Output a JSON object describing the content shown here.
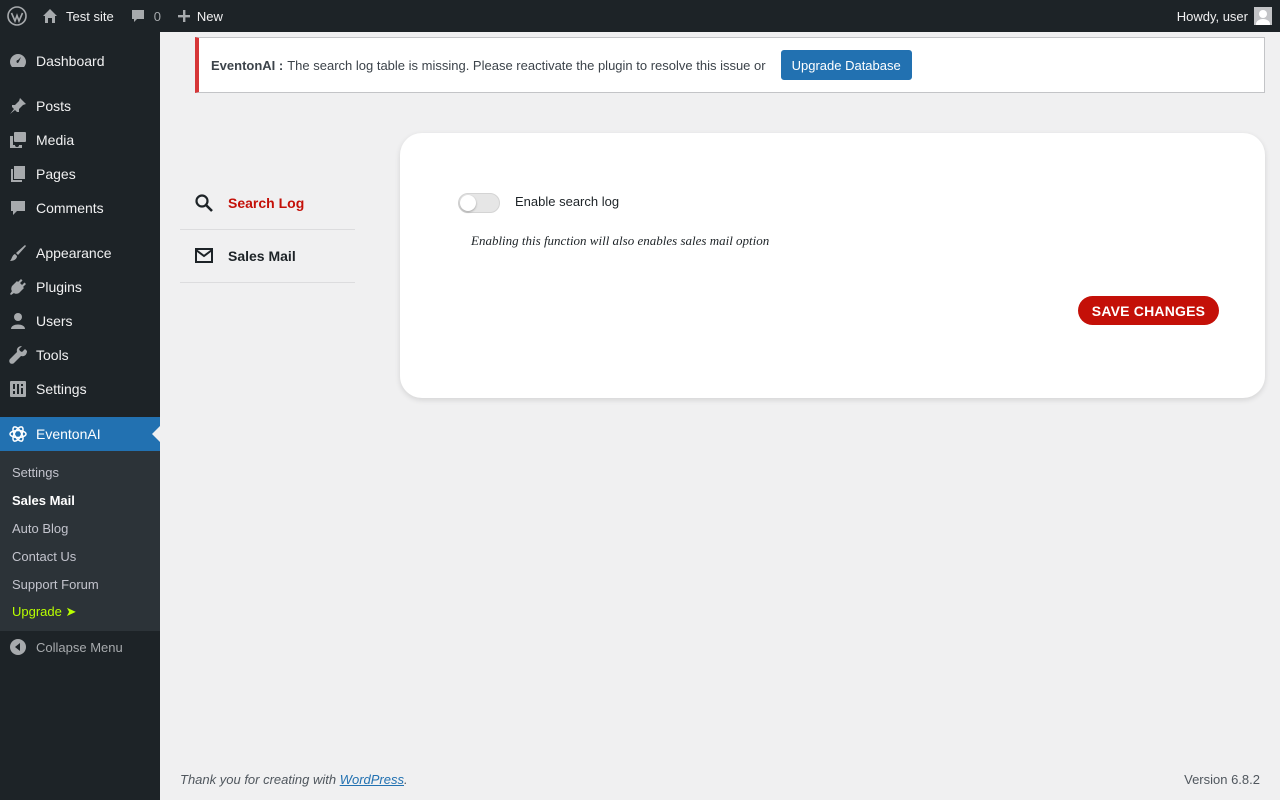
{
  "adminbar": {
    "site_name": "Test site",
    "comments_count": "0",
    "new_label": "New",
    "howdy": "Howdy, user"
  },
  "sidebar": {
    "items": [
      {
        "label": "Dashboard",
        "icon": "dashboard-icon"
      },
      {
        "label": "Posts",
        "icon": "pin-icon"
      },
      {
        "label": "Media",
        "icon": "media-icon"
      },
      {
        "label": "Pages",
        "icon": "pages-icon"
      },
      {
        "label": "Comments",
        "icon": "comment-icon"
      },
      {
        "label": "Appearance",
        "icon": "brush-icon"
      },
      {
        "label": "Plugins",
        "icon": "plug-icon"
      },
      {
        "label": "Users",
        "icon": "user-icon"
      },
      {
        "label": "Tools",
        "icon": "wrench-icon"
      },
      {
        "label": "Settings",
        "icon": "settings-icon"
      },
      {
        "label": "EventonAI",
        "icon": "openai-icon",
        "current": true
      }
    ],
    "submenu": [
      "Settings",
      "Sales Mail",
      "Auto Blog",
      "Contact Us",
      "Support Forum",
      "Upgrade ➤"
    ],
    "submenu_active": "Sales Mail",
    "collapse_label": "Collapse Menu"
  },
  "notice": {
    "plugin": "EventonAI :",
    "message": "The search log table is missing. Please reactivate the plugin to resolve this issue or",
    "button": "Upgrade Database"
  },
  "tabs": [
    {
      "label": "Search Log",
      "icon": "search-icon",
      "active": true
    },
    {
      "label": "Sales Mail",
      "icon": "mail-icon",
      "active": false
    }
  ],
  "settings": {
    "toggle_label": "Enable search log",
    "toggle_on": false,
    "help_text": "Enabling this function will also enables sales mail option",
    "save_button": "SAVE CHANGES"
  },
  "footer": {
    "thanks_prefix": "Thank you for creating with ",
    "thanks_link": "WordPress",
    "thanks_suffix": ".",
    "version": "Version 6.8.2"
  },
  "colors": {
    "accent": "#c41008",
    "wp_blue": "#2271b1",
    "admin_dark": "#1d2327",
    "upgrade_green": "#b9ff00"
  }
}
